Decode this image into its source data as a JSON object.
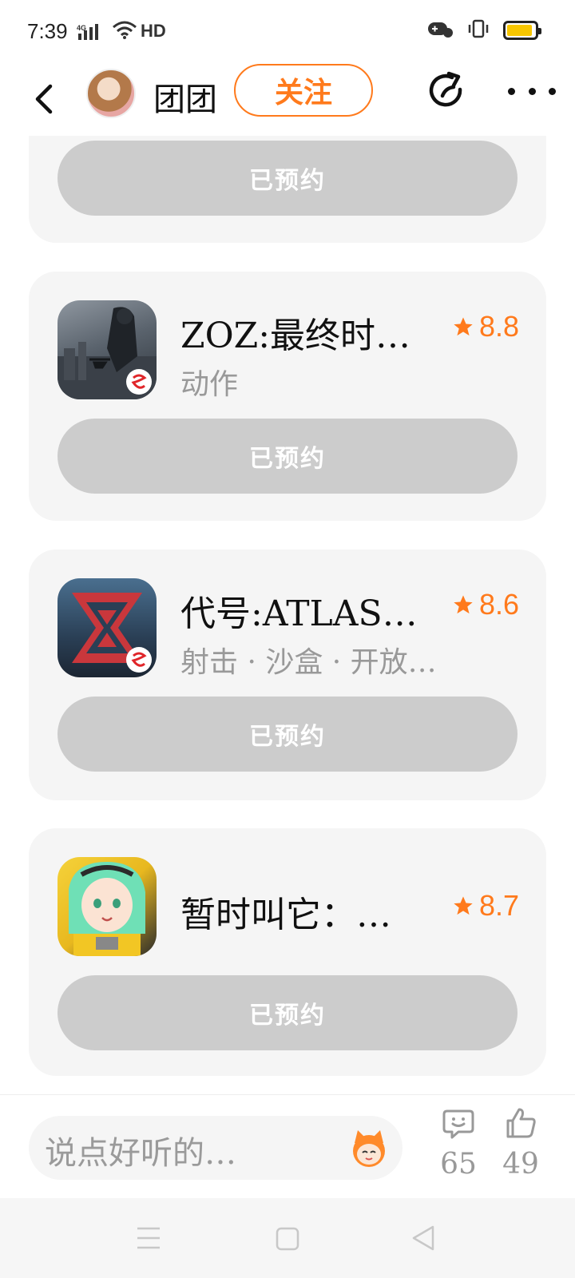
{
  "status_bar": {
    "time": "7:39",
    "network": "4G",
    "hd": "HD",
    "battery_level": 0.9,
    "battery_color": "#f7c600"
  },
  "header": {
    "username": "团团",
    "follow_label": "关注",
    "icons": [
      "back-icon",
      "share-icon",
      "more-icon"
    ]
  },
  "colors": {
    "accent": "#ff7a1c",
    "button_disabled": "#cccccc",
    "card_bg": "#f5f5f5"
  },
  "cards": [
    {
      "button_label": "已预约"
    },
    {
      "name": "ZOZ:最终时…",
      "genre": "动作",
      "rating": "8.8",
      "button_label": "已预约"
    },
    {
      "name": "代号:ATLAS…",
      "genre": "射击 · 沙盒 · 开放…",
      "rating": "8.6",
      "button_label": "已预约"
    },
    {
      "name": "暂时叫它：…",
      "rating": "8.7",
      "button_label": "已预约"
    }
  ],
  "bottom_bar": {
    "comment_placeholder": "说点好听的…",
    "comment_count": "65",
    "like_count": "49"
  }
}
